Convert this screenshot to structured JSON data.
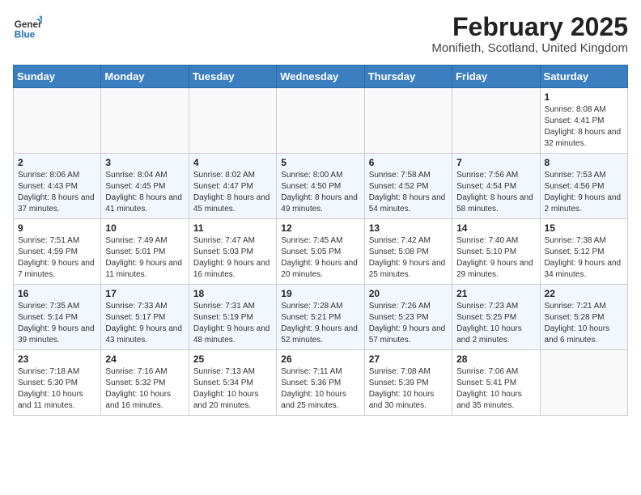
{
  "header": {
    "logo_general": "General",
    "logo_blue": "Blue",
    "month_year": "February 2025",
    "location": "Monifieth, Scotland, United Kingdom"
  },
  "weekdays": [
    "Sunday",
    "Monday",
    "Tuesday",
    "Wednesday",
    "Thursday",
    "Friday",
    "Saturday"
  ],
  "weeks": [
    [
      {
        "day": "",
        "info": ""
      },
      {
        "day": "",
        "info": ""
      },
      {
        "day": "",
        "info": ""
      },
      {
        "day": "",
        "info": ""
      },
      {
        "day": "",
        "info": ""
      },
      {
        "day": "",
        "info": ""
      },
      {
        "day": "1",
        "info": "Sunrise: 8:08 AM\nSunset: 4:41 PM\nDaylight: 8 hours and 32 minutes."
      }
    ],
    [
      {
        "day": "2",
        "info": "Sunrise: 8:06 AM\nSunset: 4:43 PM\nDaylight: 8 hours and 37 minutes."
      },
      {
        "day": "3",
        "info": "Sunrise: 8:04 AM\nSunset: 4:45 PM\nDaylight: 8 hours and 41 minutes."
      },
      {
        "day": "4",
        "info": "Sunrise: 8:02 AM\nSunset: 4:47 PM\nDaylight: 8 hours and 45 minutes."
      },
      {
        "day": "5",
        "info": "Sunrise: 8:00 AM\nSunset: 4:50 PM\nDaylight: 8 hours and 49 minutes."
      },
      {
        "day": "6",
        "info": "Sunrise: 7:58 AM\nSunset: 4:52 PM\nDaylight: 8 hours and 54 minutes."
      },
      {
        "day": "7",
        "info": "Sunrise: 7:56 AM\nSunset: 4:54 PM\nDaylight: 8 hours and 58 minutes."
      },
      {
        "day": "8",
        "info": "Sunrise: 7:53 AM\nSunset: 4:56 PM\nDaylight: 9 hours and 2 minutes."
      }
    ],
    [
      {
        "day": "9",
        "info": "Sunrise: 7:51 AM\nSunset: 4:59 PM\nDaylight: 9 hours and 7 minutes."
      },
      {
        "day": "10",
        "info": "Sunrise: 7:49 AM\nSunset: 5:01 PM\nDaylight: 9 hours and 11 minutes."
      },
      {
        "day": "11",
        "info": "Sunrise: 7:47 AM\nSunset: 5:03 PM\nDaylight: 9 hours and 16 minutes."
      },
      {
        "day": "12",
        "info": "Sunrise: 7:45 AM\nSunset: 5:05 PM\nDaylight: 9 hours and 20 minutes."
      },
      {
        "day": "13",
        "info": "Sunrise: 7:42 AM\nSunset: 5:08 PM\nDaylight: 9 hours and 25 minutes."
      },
      {
        "day": "14",
        "info": "Sunrise: 7:40 AM\nSunset: 5:10 PM\nDaylight: 9 hours and 29 minutes."
      },
      {
        "day": "15",
        "info": "Sunrise: 7:38 AM\nSunset: 5:12 PM\nDaylight: 9 hours and 34 minutes."
      }
    ],
    [
      {
        "day": "16",
        "info": "Sunrise: 7:35 AM\nSunset: 5:14 PM\nDaylight: 9 hours and 39 minutes."
      },
      {
        "day": "17",
        "info": "Sunrise: 7:33 AM\nSunset: 5:17 PM\nDaylight: 9 hours and 43 minutes."
      },
      {
        "day": "18",
        "info": "Sunrise: 7:31 AM\nSunset: 5:19 PM\nDaylight: 9 hours and 48 minutes."
      },
      {
        "day": "19",
        "info": "Sunrise: 7:28 AM\nSunset: 5:21 PM\nDaylight: 9 hours and 52 minutes."
      },
      {
        "day": "20",
        "info": "Sunrise: 7:26 AM\nSunset: 5:23 PM\nDaylight: 9 hours and 57 minutes."
      },
      {
        "day": "21",
        "info": "Sunrise: 7:23 AM\nSunset: 5:25 PM\nDaylight: 10 hours and 2 minutes."
      },
      {
        "day": "22",
        "info": "Sunrise: 7:21 AM\nSunset: 5:28 PM\nDaylight: 10 hours and 6 minutes."
      }
    ],
    [
      {
        "day": "23",
        "info": "Sunrise: 7:18 AM\nSunset: 5:30 PM\nDaylight: 10 hours and 11 minutes."
      },
      {
        "day": "24",
        "info": "Sunrise: 7:16 AM\nSunset: 5:32 PM\nDaylight: 10 hours and 16 minutes."
      },
      {
        "day": "25",
        "info": "Sunrise: 7:13 AM\nSunset: 5:34 PM\nDaylight: 10 hours and 20 minutes."
      },
      {
        "day": "26",
        "info": "Sunrise: 7:11 AM\nSunset: 5:36 PM\nDaylight: 10 hours and 25 minutes."
      },
      {
        "day": "27",
        "info": "Sunrise: 7:08 AM\nSunset: 5:39 PM\nDaylight: 10 hours and 30 minutes."
      },
      {
        "day": "28",
        "info": "Sunrise: 7:06 AM\nSunset: 5:41 PM\nDaylight: 10 hours and 35 minutes."
      },
      {
        "day": "",
        "info": ""
      }
    ]
  ]
}
